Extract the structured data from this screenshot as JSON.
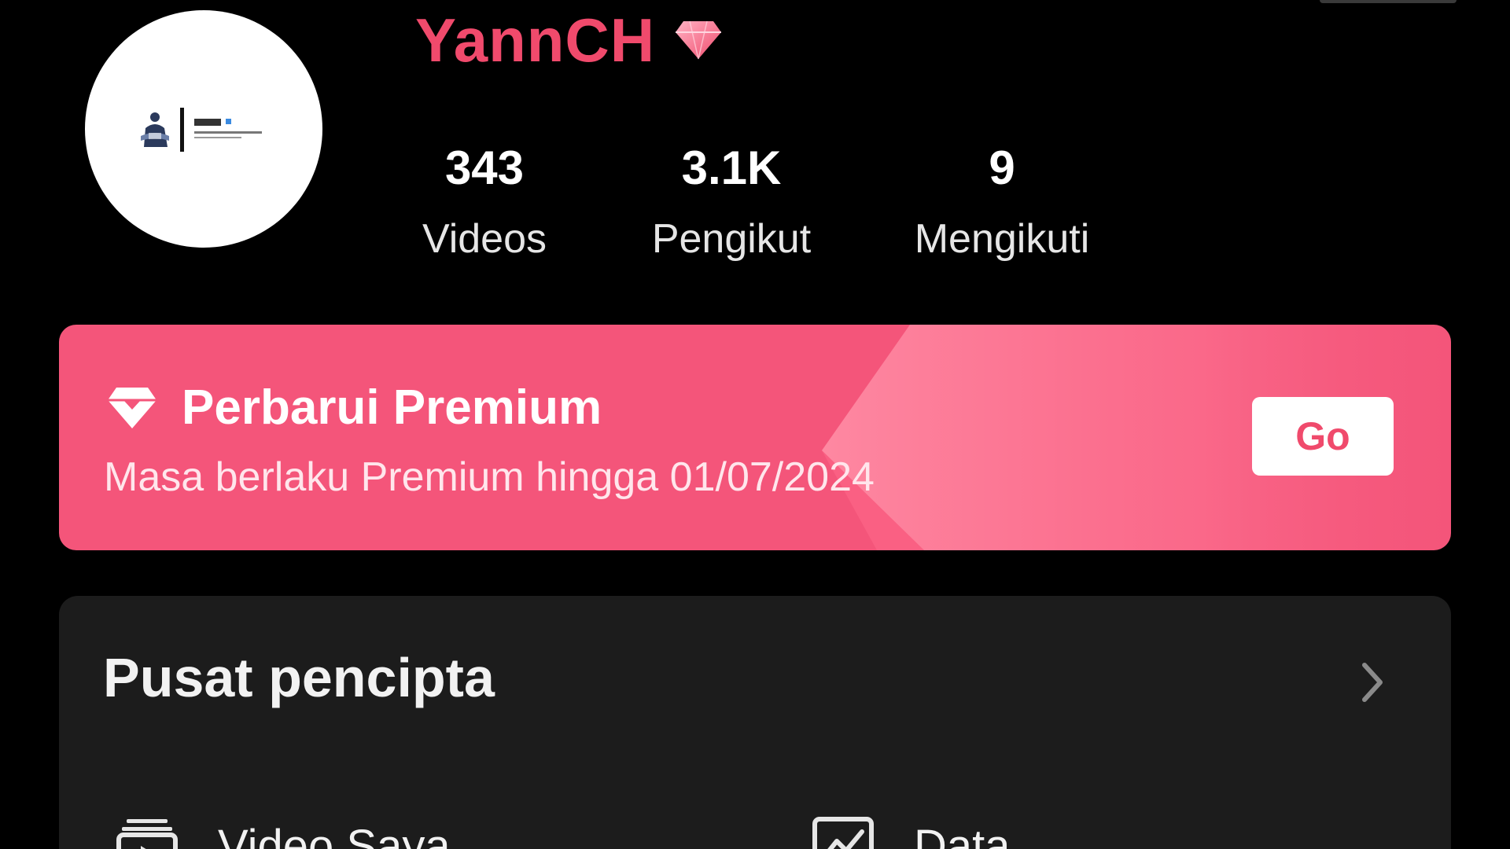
{
  "profile": {
    "username": "YannCH",
    "badge_icon": "premium-diamond-icon",
    "accent_color": "#f04a6c",
    "stats": {
      "videos": {
        "value": "343",
        "label": "Videos"
      },
      "followers": {
        "value": "3.1K",
        "label": "Pengikut"
      },
      "following": {
        "value": "9",
        "label": "Mengikuti"
      }
    }
  },
  "premium_banner": {
    "title": "Perbarui Premium",
    "subtitle": "Masa berlaku Premium hingga 01/07/2024",
    "button_label": "Go",
    "background_color": "#f4557a"
  },
  "creator_center": {
    "title": "Pusat pencipta",
    "items": [
      {
        "label": "Video Saya",
        "icon": "video-library-icon"
      },
      {
        "label": "Data",
        "icon": "chart-icon"
      }
    ]
  }
}
